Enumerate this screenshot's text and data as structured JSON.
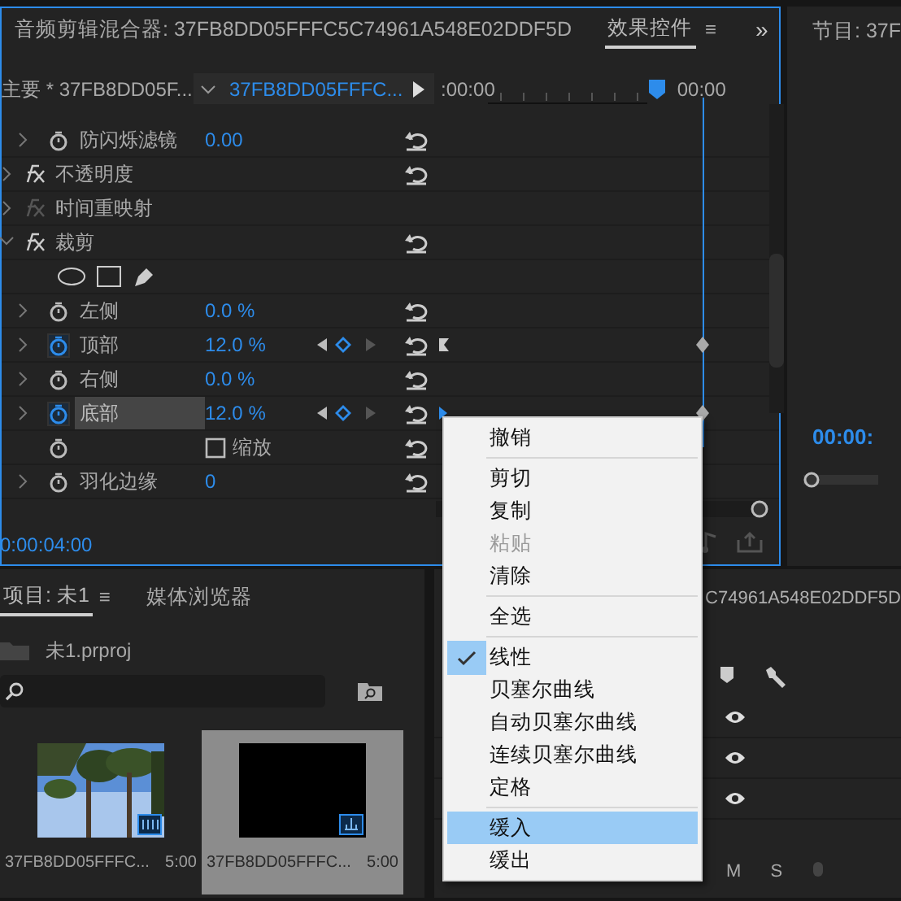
{
  "effect_panel": {
    "tabs": [
      {
        "label": "音频剪辑混合器: 37FB8DD05FFFC5C74961A548E02DDF5D",
        "selected": false
      },
      {
        "label": "效果控件",
        "selected": true
      }
    ],
    "menu_glyph": "≡",
    "expand_glyph": "»",
    "master_clip": "主要 * 37FB8DD05F...",
    "sequence_clip": "37FB8DD05FFFC...",
    "ruler_start": ":00:00",
    "ruler_end": "00:00",
    "properties": [
      {
        "kind": "param",
        "label": "防闪烁滤镜",
        "value": "0.00",
        "expanded": false,
        "animated": false,
        "reset": true,
        "selected": false
      },
      {
        "kind": "effect",
        "label": "不透明度",
        "enabled": true,
        "expanded": false,
        "reset": true
      },
      {
        "kind": "effect",
        "label": "时间重映射",
        "enabled": false,
        "expanded": false,
        "reset": false
      },
      {
        "kind": "effect",
        "label": "裁剪",
        "enabled": true,
        "expanded": true,
        "reset": true,
        "children": [
          {
            "kind": "mask_tools"
          },
          {
            "kind": "param",
            "label": "左侧",
            "value": "0.0 %",
            "expanded": false,
            "animated": false,
            "reset": true,
            "selected": false
          },
          {
            "kind": "param",
            "label": "顶部",
            "value": "12.0 %",
            "expanded": false,
            "animated": true,
            "reset": true,
            "selected": false
          },
          {
            "kind": "param",
            "label": "右侧",
            "value": "0.0 %",
            "expanded": false,
            "animated": false,
            "reset": true,
            "selected": false
          },
          {
            "kind": "param",
            "label": "底部",
            "value": "12.0 %",
            "expanded": false,
            "animated": true,
            "reset": true,
            "selected": true
          },
          {
            "kind": "checkbox",
            "label": "缩放",
            "checked": false,
            "reset": true
          },
          {
            "kind": "param",
            "label": "羽化边缘",
            "value": "0",
            "expanded": false,
            "animated": false,
            "reset": true,
            "selected": false
          }
        ]
      }
    ],
    "timecode": "0:00:04:00"
  },
  "program_panel": {
    "title": "节目: 37F",
    "timecode": "00:00:",
    "level": 0
  },
  "project_panel": {
    "tabs": [
      {
        "label": "项目: 未1",
        "selected": true
      },
      {
        "label": "媒体浏览器",
        "selected": false
      }
    ],
    "menu_glyph": "≡",
    "project_file": "未1.prproj",
    "items": [
      {
        "kind": "video",
        "name": "37FB8DD05FFFC...",
        "duration": "5:00",
        "selected": false
      },
      {
        "kind": "sequence",
        "name": "37FB8DD05FFFC...",
        "duration": "5:00",
        "selected": true
      }
    ]
  },
  "timeline_panel": {
    "title": "C74961A548E02DDF5D",
    "track_buttons": [
      "M",
      "S"
    ]
  },
  "context_menu": [
    {
      "kind": "item",
      "label": "撤销",
      "disabled": false,
      "checked": false,
      "selected": false
    },
    {
      "kind": "separator"
    },
    {
      "kind": "item",
      "label": "剪切",
      "disabled": false,
      "checked": false,
      "selected": false
    },
    {
      "kind": "item",
      "label": "复制",
      "disabled": false,
      "checked": false,
      "selected": false
    },
    {
      "kind": "item",
      "label": "粘贴",
      "disabled": true,
      "checked": false,
      "selected": false
    },
    {
      "kind": "item",
      "label": "清除",
      "disabled": false,
      "checked": false,
      "selected": false
    },
    {
      "kind": "separator"
    },
    {
      "kind": "item",
      "label": "全选",
      "disabled": false,
      "checked": false,
      "selected": false
    },
    {
      "kind": "separator"
    },
    {
      "kind": "item",
      "label": "线性",
      "disabled": false,
      "checked": true,
      "selected": false
    },
    {
      "kind": "item",
      "label": "贝塞尔曲线",
      "disabled": false,
      "checked": false,
      "selected": false
    },
    {
      "kind": "item",
      "label": "自动贝塞尔曲线",
      "disabled": false,
      "checked": false,
      "selected": false
    },
    {
      "kind": "item",
      "label": "连续贝塞尔曲线",
      "disabled": false,
      "checked": false,
      "selected": false
    },
    {
      "kind": "item",
      "label": "定格",
      "disabled": false,
      "checked": false,
      "selected": false
    },
    {
      "kind": "separator"
    },
    {
      "kind": "item",
      "label": "缓入",
      "disabled": false,
      "checked": false,
      "selected": true
    },
    {
      "kind": "item",
      "label": "缓出",
      "disabled": false,
      "checked": false,
      "selected": false
    }
  ]
}
